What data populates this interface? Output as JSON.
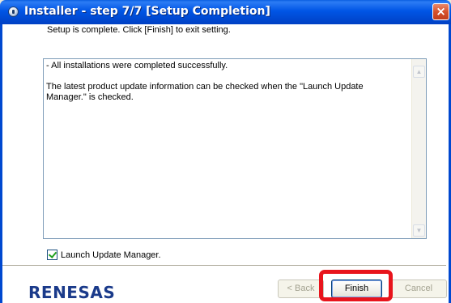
{
  "window": {
    "title": "Installer - step 7/7 [Setup Completion]",
    "close_label": "×"
  },
  "instruction": "Setup is complete. Click [Finish] to exit setting.",
  "message": {
    "line1": "- All installations were completed successfully.",
    "line2": "The latest product update information can be checked when the \"Launch Update Manager.\" is checked."
  },
  "option": {
    "label": "Launch Update Manager.",
    "checked": true
  },
  "logo": "RENESAS",
  "buttons": {
    "back": "< Back",
    "finish": "Finish",
    "cancel": "Cancel"
  },
  "colors": {
    "titlebar": "#0055e5",
    "highlight": "#e8141c",
    "logo": "#1a3a8a"
  }
}
